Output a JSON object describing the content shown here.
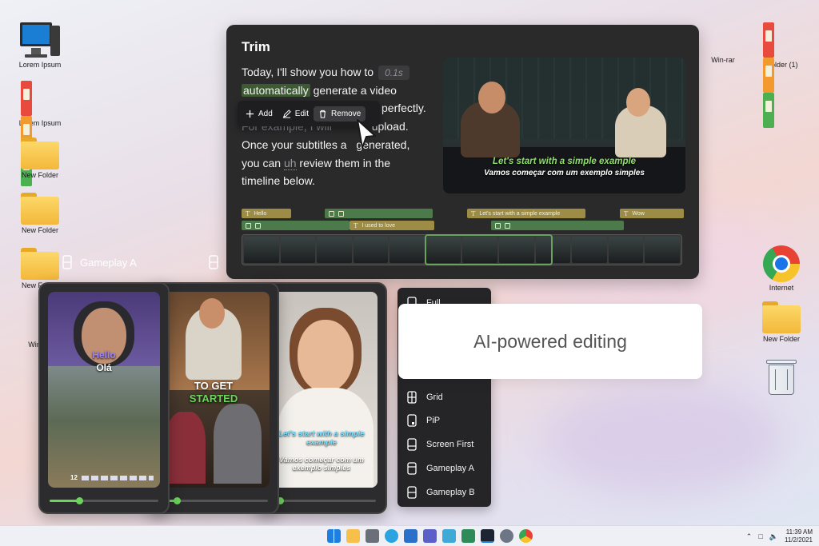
{
  "desktop": {
    "left_icons": [
      "Lorem Ipsum",
      "Lorem Ipsum",
      "New Folder",
      "New Folder",
      "New Folder",
      "Win-rar"
    ],
    "right_icons": [
      "Win-rar",
      "Folder (1)",
      "Internet",
      "New Folder"
    ]
  },
  "editor": {
    "title": "Trim",
    "transcript": {
      "line1": "Today, I'll show you how to",
      "pause": "0.1s",
      "line2_hl": "automatically",
      "line2_rest": "generate a video",
      "line3": "perfectly.",
      "line4_a": "For example, I will",
      "line4_b": "upload.",
      "line5_a": "Once your subtitles a",
      "line5_b": "generated,",
      "line6_a": "you can",
      "filler": "uh",
      "line6_b": "review them in the",
      "line7": "timeline below."
    },
    "context_menu": {
      "add": "Add",
      "edit": "Edit",
      "remove": "Remove"
    },
    "video": {
      "subtitle_en": "Let's start with a simple example",
      "subtitle_pt": "Vamos começar com um exemplo simples"
    },
    "tracks": {
      "hello": "Hello",
      "love": "I used to love",
      "simple": "Let's start with a simple example",
      "wow": "Wow"
    }
  },
  "phones": {
    "gameplay_label": "Gameplay A",
    "p1_caption_en": "Hello",
    "p1_caption_pt": "Olá",
    "p1_hud": "12",
    "p2_caption_a": "TO GET",
    "p2_caption_b": "STARTED",
    "p3_caption_en": "Let's start with a simple example",
    "p3_caption_pt": "Vamos começar com um exemplo simples",
    "progress": [
      0.27,
      0.16,
      0.12
    ]
  },
  "layout_list": {
    "items": [
      "Full",
      "Grid",
      "PiP",
      "Screen First",
      "Gameplay A",
      "Gameplay B"
    ]
  },
  "ai_card": {
    "text": "AI-powered editing"
  },
  "taskbar": {
    "clock_time": "11:39 AM",
    "clock_date": "11/2/2021",
    "icons": [
      "windows-start-icon",
      "file-explorer-icon",
      "camera-icon",
      "edge-icon",
      "store-icon",
      "teams-icon",
      "photos-icon",
      "xbox-icon",
      "editor-app-icon",
      "settings-icon",
      "chrome-icon"
    ]
  },
  "colors": {
    "accent_green": "#6bd45a",
    "highlight_green": "#3e5a35",
    "track_yellow": "#9c8c46",
    "track_green": "#4d7a4a",
    "panel_dark": "#2a2a2b"
  }
}
